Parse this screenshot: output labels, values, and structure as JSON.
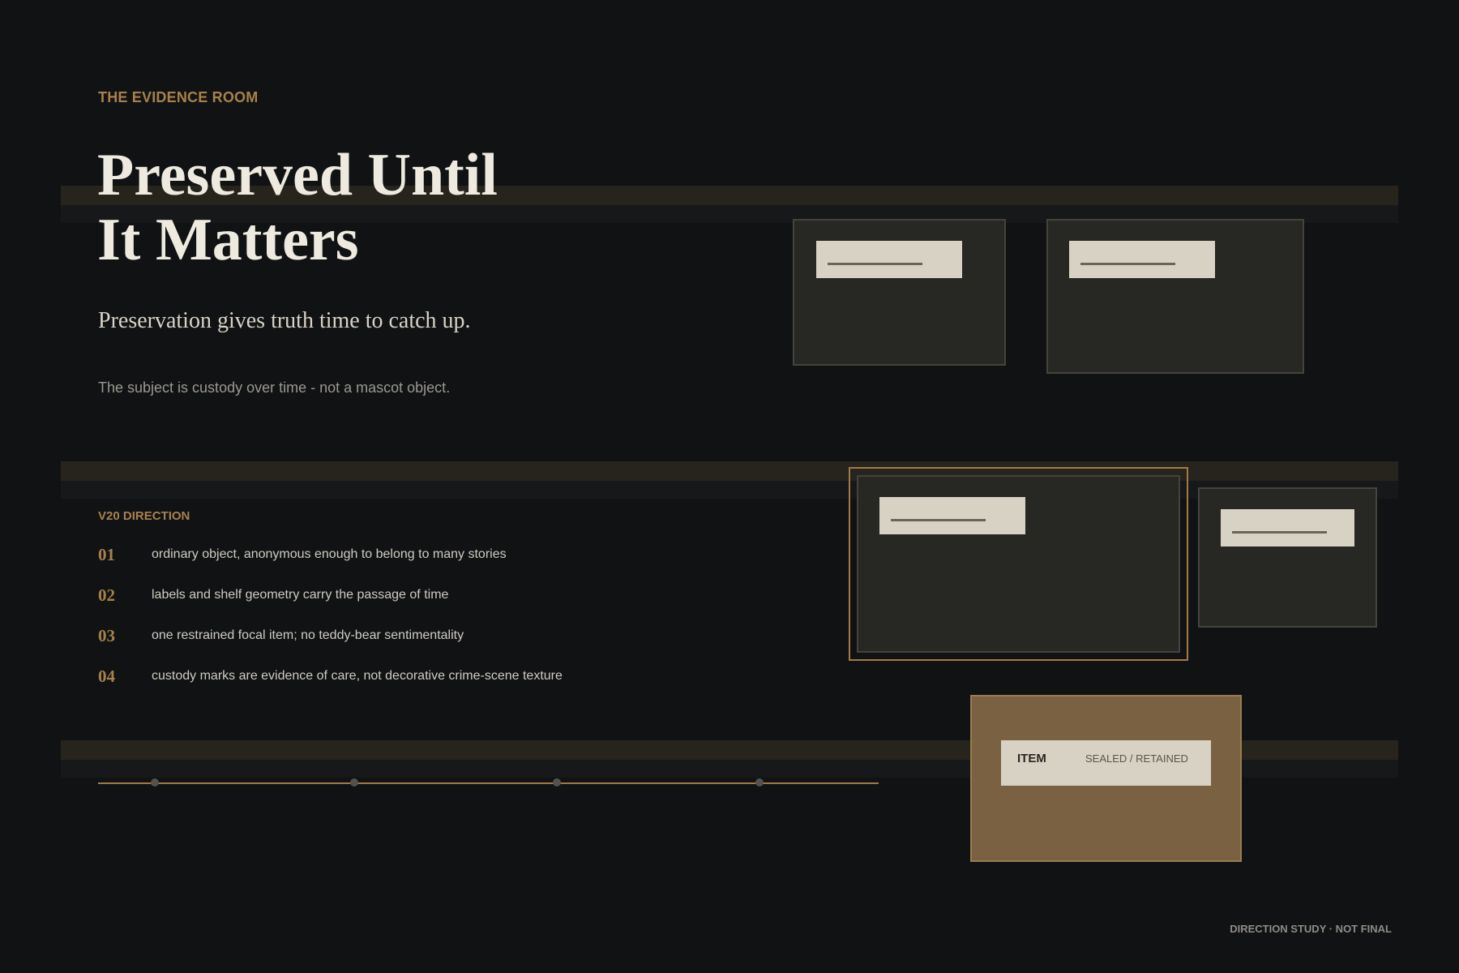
{
  "header": {
    "eyebrow": "THE EVIDENCE ROOM",
    "title_line_1": "Preserved Until",
    "title_line_2": "It Matters",
    "subtitle": "Preservation gives truth time to catch up.",
    "note": "The subject is custody over time - not a mascot object."
  },
  "direction": {
    "label": "V20 DIRECTION",
    "items": [
      {
        "num": "01",
        "text": "ordinary object, anonymous enough to belong to many stories"
      },
      {
        "num": "02",
        "text": "labels and shelf geometry carry the passage of time"
      },
      {
        "num": "03",
        "text": "one restrained focal item; no teddy-bear sentimentality"
      },
      {
        "num": "04",
        "text": "custody marks are evidence of care, not decorative crime-scene texture"
      }
    ]
  },
  "evidence_tag": {
    "item": "ITEM",
    "status": "SEALED / RETAINED"
  },
  "footer": {
    "note": "DIRECTION STUDY · NOT FINAL"
  },
  "colors": {
    "background": "#101214",
    "accent": "#a8814a",
    "headline": "#eeeadf",
    "box": "#272823",
    "label": "#d8d2c5",
    "evidence_card": "#7a6142"
  }
}
